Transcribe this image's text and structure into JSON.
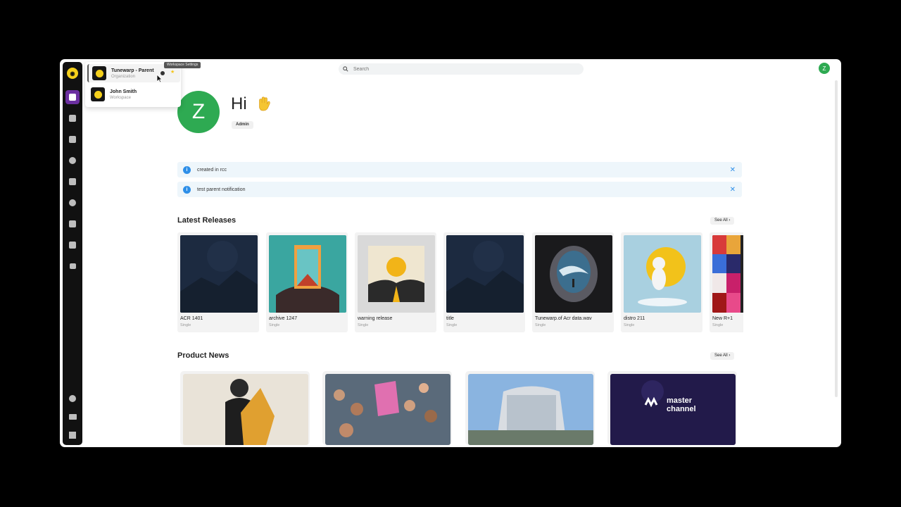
{
  "search": {
    "placeholder": "Search"
  },
  "user": {
    "initial": "Z"
  },
  "workspaces": [
    {
      "name": "Tunewarp - Parent",
      "type": "Organization"
    },
    {
      "name": "John Smith",
      "type": "Workspace"
    }
  ],
  "tooltip": "Workspace Settings",
  "hero": {
    "greeting": "Hi",
    "role": "Admin"
  },
  "notifications": [
    {
      "text": "created in rcc"
    },
    {
      "text": "test parent notification"
    }
  ],
  "latest_releases": {
    "title": "Latest Releases",
    "see_all": "See All",
    "items": [
      {
        "title": "ACR 1401",
        "type": "Single"
      },
      {
        "title": "archive 1247",
        "type": "Single"
      },
      {
        "title": "warning release",
        "type": "Single"
      },
      {
        "title": "title",
        "type": "Single"
      },
      {
        "title": "Tunewarp.of Acr data.wav",
        "type": "Single"
      },
      {
        "title": "distro 211",
        "type": "Single"
      },
      {
        "title": "New R+1",
        "type": "Single"
      }
    ]
  },
  "product_news": {
    "title": "Product News",
    "see_all": "See All",
    "items": [
      {
        "image_text": ""
      },
      {
        "image_text": ""
      },
      {
        "image_text": ""
      },
      {
        "image_text": "master channel"
      }
    ]
  },
  "colors": {
    "accent": "#6b2fa0",
    "brand": "#f5d01b",
    "avatar": "#2eaa52",
    "info": "#2e8fe8"
  }
}
